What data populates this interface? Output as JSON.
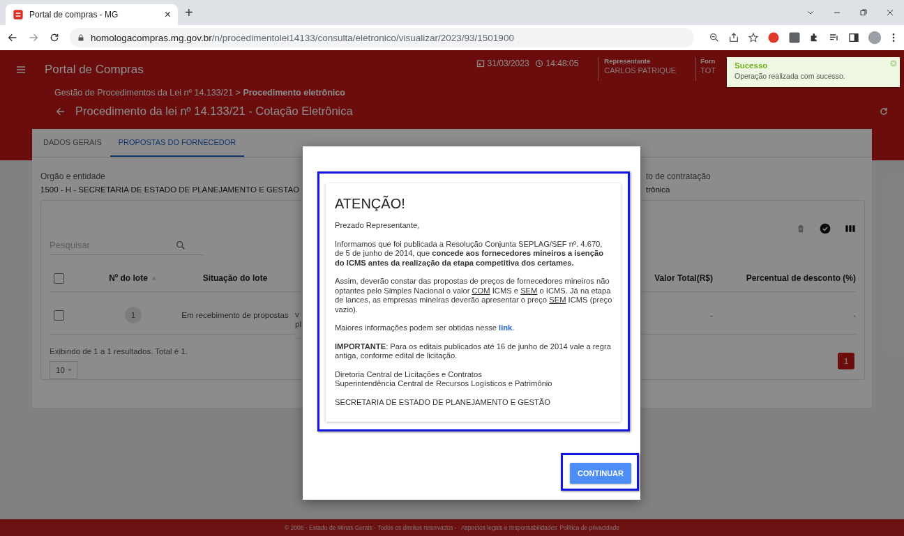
{
  "browser": {
    "tab": {
      "title": "Portal de compras - MG",
      "close": "×",
      "selected": true
    },
    "new_tab": "+",
    "url_domain": "homologacompras.mg.gov.br",
    "url_path": "/n/procedimentolei14133/consulta/eletronico/visualizar/2023/93/1501900"
  },
  "header": {
    "app_title": "Portal de Compras",
    "date": "31/03/2023",
    "time": "14:48:05",
    "user_fields": [
      {
        "label": "Representante",
        "value": "CARLOS PATRIQUE"
      },
      {
        "label": "Forn",
        "value": "TOT"
      }
    ],
    "breadcrumb": "Gestão de Procedimentos da Lei nº 14.133/21 > **Procedimento eletrônico**",
    "page_title": "Procedimento da lei nº 14.133/21 - Cotação Eletrônica"
  },
  "tabs": [
    {
      "label": "DADOS GERAIS",
      "selected": false
    },
    {
      "label": "PROPOSTAS DO FORNECEDOR",
      "selected": true
    }
  ],
  "fields": [
    {
      "label": "Orgão e entidade",
      "value": "1500 - H - SECRETARIA DE ESTADO DE PLANEJAMENTO E GESTAO"
    },
    {
      "label": "to de contratação",
      "value": "trônica"
    }
  ],
  "search": {
    "placeholder": "Pesquisar"
  },
  "table": {
    "all_checked": false,
    "columns": [
      {
        "label": "Nº do lote",
        "sorted": true
      },
      {
        "label": "Situação do lote",
        "sorted": false
      },
      {
        "label": "Valor Total(R$)",
        "sorted": false
      },
      {
        "label": "Percentual de desconto (%)",
        "sorted": false
      }
    ],
    "rows": [
      {
        "checked": false,
        "lote": "1",
        "situacao": "Em recebimento de propostas",
        "column_3": [
          "v",
          "pl"
        ],
        "valor": "-",
        "percentual": "-"
      }
    ]
  },
  "summary": "Exibindo de 1 a 1 resultados. Total é 1.",
  "page_size": "10",
  "pages": [
    {
      "label": "1",
      "selected": true
    }
  ],
  "toast": {
    "title": "Sucesso",
    "message": "Operação realizada com sucesso."
  },
  "dialog": {
    "title": "ATENÇÃO!",
    "highlight": true,
    "paragraphs": [
      {
        "segments": [
          {
            "kind": "plain",
            "text": "Prezado Representante,"
          }
        ]
      },
      {
        "segments": [
          {
            "kind": "plain",
            "text": "Informamos que foi publicada a Resolução Conjunta SEPLAG/SEF nº. 4.670, de 5 de junho de 2014, que "
          },
          {
            "kind": "bold",
            "text": "concede aos fornecedores mineiros a isenção do ICMS antes da realização da etapa competitiva dos certames."
          }
        ]
      },
      {
        "segments": [
          {
            "kind": "plain",
            "text": "Assim, deverão constar das propostas de preços de fornecedores mineiros não optantes pelo Simples Nacional o valor "
          },
          {
            "kind": "underline",
            "text": "COM"
          },
          {
            "kind": "plain",
            "text": " ICMS e "
          },
          {
            "kind": "underline",
            "text": "SEM"
          },
          {
            "kind": "plain",
            "text": " o ICMS. Já na etapa de lances, as empresas mineiras deverão apresentar o preço "
          },
          {
            "kind": "underline",
            "text": "SEM"
          },
          {
            "kind": "plain",
            "text": " ICMS (preço vazio)."
          }
        ]
      },
      {
        "segments": [
          {
            "kind": "plain",
            "text": "Maiores informações podem ser obtidas nesse "
          },
          {
            "kind": "link",
            "text": "link"
          },
          {
            "kind": "plain",
            "text": "."
          }
        ]
      },
      {
        "segments": [
          {
            "kind": "bold",
            "text": "IMPORTANTE"
          },
          {
            "kind": "plain",
            "text": ": Para os editais publicados até 16 de junho de 2014 vale a regra antiga, conforme edital de licitação."
          }
        ]
      },
      {
        "lines": [
          "Diretoria Central de Licitações e Contratos",
          "Superintendência Central de Recursos Logísticos e Patrimônio"
        ]
      },
      {
        "segments": [
          {
            "kind": "plain",
            "text": "SECRETARIA DE ESTADO DE PLANEJAMENTO E GESTÃO"
          }
        ]
      }
    ],
    "button": {
      "label": "CONTINUAR",
      "highlight": true
    }
  },
  "footer": {
    "text": "© 2008 - Estado de Minas Gerais - Todos os direitos reservados - ",
    "links": [
      "Aspectos legais e responsabilidades",
      "Política de privacidade"
    ]
  }
}
